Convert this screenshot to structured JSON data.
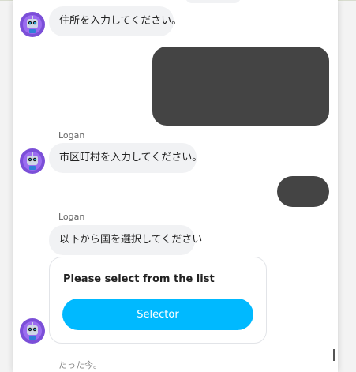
{
  "messages": {
    "bot1": {
      "text": "住所を入力してください。"
    },
    "bot2": {
      "sender": "Logan",
      "text": "市区町村を入力してください。"
    },
    "bot3": {
      "sender": "Logan",
      "text": "以下から国を選択してください"
    }
  },
  "card": {
    "title": "Please select from the list",
    "button_label": "Selector"
  },
  "timestamp": "たった今。",
  "colors": {
    "accent": "#00b9ff",
    "bot_bubble": "#f1f2f4",
    "user_bubble_redacted": "#444444"
  }
}
